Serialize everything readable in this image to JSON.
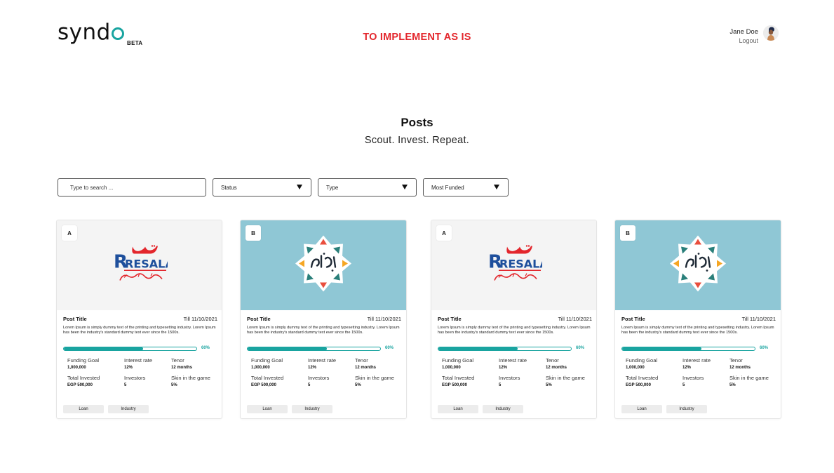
{
  "header": {
    "logo_text": "syndo",
    "beta_label": "BETA",
    "banner": "TO IMPLEMENT AS IS",
    "user_name": "Jane Doe",
    "logout_label": "Logout"
  },
  "hero": {
    "title": "Posts",
    "subtitle": "Scout. Invest. Repeat."
  },
  "filters": {
    "search_placeholder": "Type to search ...",
    "status_label": "Status",
    "type_label": "Type",
    "sort_label": "Most Funded"
  },
  "colors": {
    "accent": "#19a4a0",
    "banner": "#e3262c",
    "card_image_blue": "#8fc7d5",
    "card_image_gray": "#f4f4f4"
  },
  "cards": [
    {
      "badge": "A",
      "logo": "resala-logo",
      "logo_text": "RESALA",
      "title": "Post Title",
      "date": "Till 11/10/2021",
      "description": "Lorem Ipsum is simply dummy text of the printing and typesetting industry. Lorem Ipsum has been the industry's standard dummy text ever since the 1500s.",
      "progress_percent": 60,
      "progress_label": "60%",
      "funding_goal_label": "Funding Goal",
      "funding_goal_value": "1,000,000",
      "interest_rate_label": "Interest rate",
      "interest_rate_value": "12%",
      "tenor_label": "Tenor",
      "tenor_value": "12 months",
      "total_invested_label": "Total Invested",
      "total_invested_value": "EGP 500,000",
      "investors_label": "Investors",
      "investors_value": "5",
      "skin_label": "Skin in the game",
      "skin_value": "5%",
      "tags": [
        "Loan",
        "Industry"
      ]
    },
    {
      "badge": "B",
      "logo": "ahl-masr-logo",
      "title": "Post Title",
      "date": "Till 11/10/2021",
      "description": "Lorem Ipsum is simply dummy text of the printing and typesetting industry. Lorem Ipsum has been the industry's standard dummy text ever since the 1500s.",
      "progress_percent": 60,
      "progress_label": "60%",
      "funding_goal_label": "Funding Goal",
      "funding_goal_value": "1,000,000",
      "interest_rate_label": "Interest rate",
      "interest_rate_value": "12%",
      "tenor_label": "Tenor",
      "tenor_value": "12 months",
      "total_invested_label": "Total Invested",
      "total_invested_value": "EGP 500,000",
      "investors_label": "Investors",
      "investors_value": "5",
      "skin_label": "Skin in the game",
      "skin_value": "5%",
      "tags": [
        "Loan",
        "Industry"
      ]
    },
    {
      "badge": "A",
      "logo": "resala-logo",
      "logo_text": "RESALA",
      "title": "Post Title",
      "date": "Till 11/10/2021",
      "description": "Lorem Ipsum is simply dummy text of the printing and typesetting industry. Lorem Ipsum has been the industry's standard dummy text ever since the 1500s.",
      "progress_percent": 60,
      "progress_label": "60%",
      "funding_goal_label": "Funding Goal",
      "funding_goal_value": "1,000,000",
      "interest_rate_label": "Interest rate",
      "interest_rate_value": "12%",
      "tenor_label": "Tenor",
      "tenor_value": "12 months",
      "total_invested_label": "Total Invested",
      "total_invested_value": "EGP 500,000",
      "investors_label": "Investors",
      "investors_value": "5",
      "skin_label": "Skin in the game",
      "skin_value": "5%",
      "tags": [
        "Loan",
        "Industry"
      ]
    },
    {
      "badge": "B",
      "logo": "ahl-masr-logo",
      "title": "Post Title",
      "date": "Till 11/10/2021",
      "description": "Lorem Ipsum is simply dummy text of the printing and typesetting industry. Lorem Ipsum has been the industry's standard dummy text ever since the 1500s.",
      "progress_percent": 60,
      "progress_label": "60%",
      "funding_goal_label": "Funding Goal",
      "funding_goal_value": "1,000,000",
      "interest_rate_label": "Interest rate",
      "interest_rate_value": "12%",
      "tenor_label": "Tenor",
      "tenor_value": "12 months",
      "total_invested_label": "Total Invested",
      "total_invested_value": "EGP 500,000",
      "investors_label": "Investors",
      "investors_value": "5",
      "skin_label": "Skin in the game",
      "skin_value": "5%",
      "tags": [
        "Loan",
        "Industry"
      ]
    }
  ]
}
